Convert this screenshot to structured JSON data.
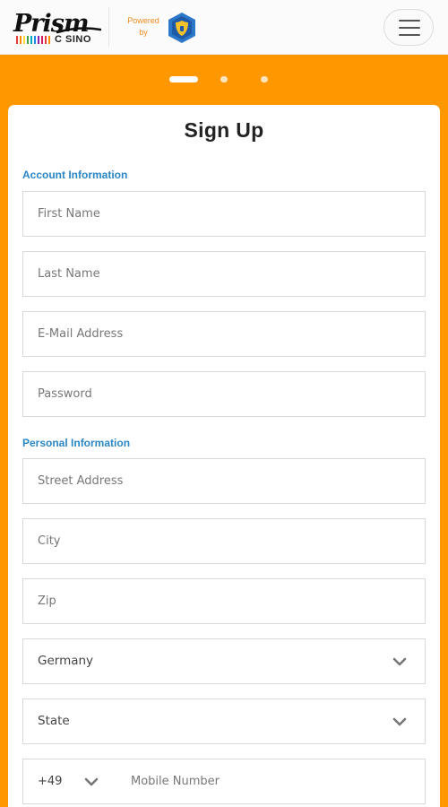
{
  "header": {
    "logo_word": "Prism",
    "logo_sub": "C SINO",
    "powered_line1": "Powered",
    "powered_line2": "by"
  },
  "colors": {
    "accent": "#ff9800",
    "section_heading": "#2b86c5",
    "powered_text": "#f08a1c",
    "shield": "#2d77c9"
  },
  "carousel": {
    "slides": 3,
    "active_index": 0
  },
  "form": {
    "title": "Sign Up",
    "sections": {
      "account": "Account Information",
      "personal": "Personal Information"
    },
    "fields": {
      "first_name": "First Name",
      "last_name": "Last Name",
      "email": "E-Mail Address",
      "password": "Password",
      "street": "Street Address",
      "city": "City",
      "zip": "Zip"
    },
    "country": {
      "selected": "Germany"
    },
    "state": {
      "selected": "State"
    },
    "phone": {
      "code": "+49",
      "placeholder": "Mobile Number"
    }
  },
  "icons": {
    "menu": "hamburger-menu-icon",
    "shield": "shield-icon",
    "dropdown": "chevron-down-icon"
  }
}
